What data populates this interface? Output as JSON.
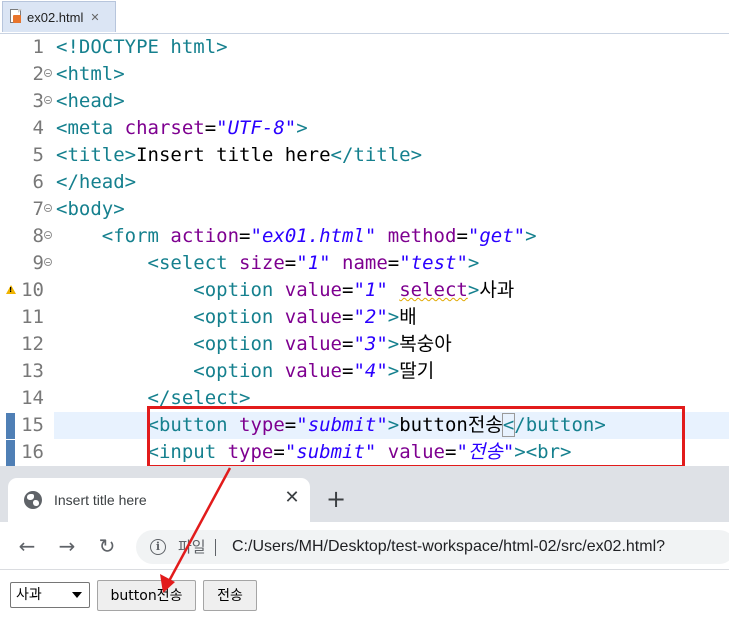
{
  "editor": {
    "tab": {
      "title": "ex02.html",
      "close_icon": "✕"
    },
    "lines": [
      {
        "num": "1",
        "tokens": [
          [
            "tag",
            "<!DOCTYPE "
          ],
          [
            "kw",
            "html"
          ],
          [
            "tag",
            ">"
          ]
        ]
      },
      {
        "num": "2",
        "fold": true,
        "tokens": [
          [
            "tag",
            "<html>"
          ]
        ]
      },
      {
        "num": "3",
        "fold": true,
        "tokens": [
          [
            "tag",
            "<head>"
          ]
        ]
      },
      {
        "num": "4",
        "tokens": [
          [
            "tag",
            "<meta "
          ],
          [
            "attr",
            "charset"
          ],
          [
            "text",
            "="
          ],
          [
            "val",
            "\"UTF-8\""
          ],
          [
            "tag",
            ">"
          ]
        ]
      },
      {
        "num": "5",
        "tokens": [
          [
            "tag",
            "<title>"
          ],
          [
            "text",
            "Insert title here"
          ],
          [
            "tag",
            "</title>"
          ]
        ]
      },
      {
        "num": "6",
        "tokens": [
          [
            "tag",
            "</head>"
          ]
        ]
      },
      {
        "num": "7",
        "fold": true,
        "tokens": [
          [
            "tag",
            "<body>"
          ]
        ]
      },
      {
        "num": "8",
        "fold": true,
        "tokens": [
          [
            "text",
            "    "
          ],
          [
            "tag",
            "<form "
          ],
          [
            "attr",
            "action"
          ],
          [
            "text",
            "="
          ],
          [
            "val",
            "\"ex01.html\""
          ],
          [
            "text",
            " "
          ],
          [
            "attr",
            "method"
          ],
          [
            "text",
            "="
          ],
          [
            "val",
            "\"get\""
          ],
          [
            "tag",
            ">"
          ]
        ]
      },
      {
        "num": "9",
        "fold": true,
        "tokens": [
          [
            "text",
            "        "
          ],
          [
            "tag",
            "<select "
          ],
          [
            "attr",
            "size"
          ],
          [
            "text",
            "="
          ],
          [
            "val",
            "\"1\""
          ],
          [
            "text",
            " "
          ],
          [
            "attr",
            "name"
          ],
          [
            "text",
            "="
          ],
          [
            "val",
            "\"test\""
          ],
          [
            "tag",
            ">"
          ]
        ]
      },
      {
        "num": "10",
        "warning": true,
        "tokens": [
          [
            "text",
            "            "
          ],
          [
            "tag",
            "<option "
          ],
          [
            "attr",
            "value"
          ],
          [
            "text",
            "="
          ],
          [
            "val",
            "\"1\""
          ],
          [
            "text",
            " "
          ],
          [
            "attrwarn",
            "select"
          ],
          [
            "tag",
            ">"
          ],
          [
            "text",
            "사과"
          ]
        ]
      },
      {
        "num": "11",
        "tokens": [
          [
            "text",
            "            "
          ],
          [
            "tag",
            "<option "
          ],
          [
            "attr",
            "value"
          ],
          [
            "text",
            "="
          ],
          [
            "val",
            "\"2\""
          ],
          [
            "tag",
            ">"
          ],
          [
            "text",
            "배"
          ]
        ]
      },
      {
        "num": "12",
        "tokens": [
          [
            "text",
            "            "
          ],
          [
            "tag",
            "<option "
          ],
          [
            "attr",
            "value"
          ],
          [
            "text",
            "="
          ],
          [
            "val",
            "\"3\""
          ],
          [
            "tag",
            ">"
          ],
          [
            "text",
            "복숭아"
          ]
        ]
      },
      {
        "num": "13",
        "tokens": [
          [
            "text",
            "            "
          ],
          [
            "tag",
            "<option "
          ],
          [
            "attr",
            "value"
          ],
          [
            "text",
            "="
          ],
          [
            "val",
            "\"4\""
          ],
          [
            "tag",
            ">"
          ],
          [
            "text",
            "딸기"
          ]
        ]
      },
      {
        "num": "14",
        "tokens": [
          [
            "text",
            "        "
          ],
          [
            "tag",
            "</select>"
          ]
        ]
      },
      {
        "num": "15",
        "changed": true,
        "current": true,
        "tokens": [
          [
            "text",
            "        "
          ],
          [
            "tag",
            "<button "
          ],
          [
            "attr",
            "type"
          ],
          [
            "text",
            "="
          ],
          [
            "val",
            "\"submit\""
          ],
          [
            "tag",
            ">"
          ],
          [
            "text",
            "button전송"
          ],
          [
            "tagbox",
            "<"
          ],
          [
            "tag",
            "/button>"
          ]
        ]
      },
      {
        "num": "16",
        "changed": true,
        "tokens": [
          [
            "text",
            "        "
          ],
          [
            "tag",
            "<input "
          ],
          [
            "attr",
            "type"
          ],
          [
            "text",
            "="
          ],
          [
            "val",
            "\"submit\""
          ],
          [
            "text",
            " "
          ],
          [
            "attr",
            "value"
          ],
          [
            "text",
            "="
          ],
          [
            "val",
            "\"전송\""
          ],
          [
            "tag",
            "><br>"
          ]
        ]
      }
    ]
  },
  "browser": {
    "tab_title": "Insert title here",
    "tab_close": "✕",
    "new_tab": "+",
    "nav": {
      "back": "←",
      "forward": "→",
      "reload": "↻"
    },
    "omnibox": {
      "info_icon": "i",
      "label": "파일",
      "url": "C:/Users/MH/Desktop/test-workspace/html-02/src/ex02.html?"
    },
    "page": {
      "select_value": "사과",
      "button_label": "button전송",
      "submit_label": "전송"
    }
  },
  "annotation": {
    "highlight_color": "#e21b1b"
  }
}
